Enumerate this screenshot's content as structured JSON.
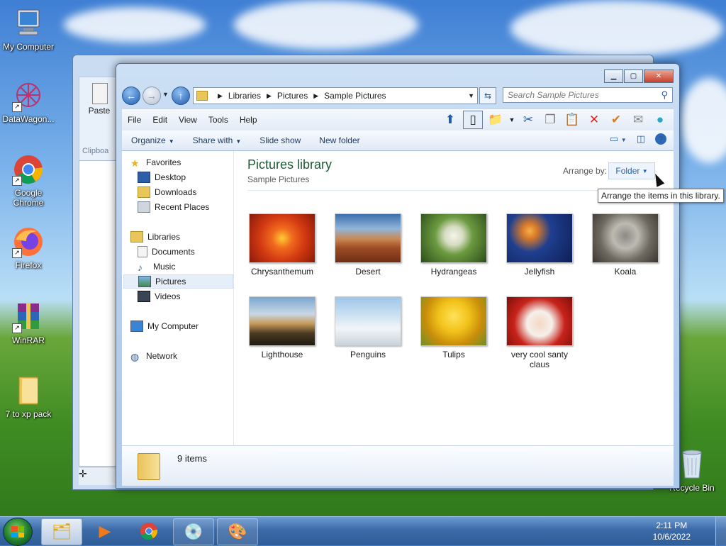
{
  "desktop": {
    "icons": [
      {
        "label": "My Computer",
        "icon": "computer-icon"
      },
      {
        "label": "DataWagon...",
        "icon": "datawagon-icon"
      },
      {
        "label": "Google Chrome",
        "icon": "chrome-icon"
      },
      {
        "label": "Firefox",
        "icon": "firefox-icon"
      },
      {
        "label": "WinRAR",
        "icon": "winrar-icon"
      },
      {
        "label": "7 to xp pack",
        "icon": "folder-icon"
      },
      {
        "label": "Recycle Bin",
        "icon": "recycle-bin-icon"
      }
    ]
  },
  "background_window": {
    "paste_label": "Paste",
    "clipboard_label": "Clipboa"
  },
  "window": {
    "address": {
      "segments": [
        "Libraries",
        "Pictures",
        "Sample Pictures"
      ]
    },
    "search": {
      "placeholder": "Search Sample Pictures"
    },
    "menu": [
      "File",
      "Edit",
      "View",
      "Tools",
      "Help"
    ],
    "commands": {
      "organize": "Organize",
      "share_with": "Share with",
      "slide_show": "Slide show",
      "new_folder": "New folder"
    },
    "nav": {
      "favorites": "Favorites",
      "desktop": "Desktop",
      "downloads": "Downloads",
      "recent_places": "Recent Places",
      "libraries": "Libraries",
      "documents": "Documents",
      "music": "Music",
      "pictures": "Pictures",
      "videos": "Videos",
      "my_computer": "My Computer",
      "network": "Network"
    },
    "library": {
      "title": "Pictures library",
      "subtitle": "Sample Pictures",
      "arrange_by_label": "Arrange by:",
      "arrange_by_value": "Folder"
    },
    "items": [
      {
        "name": "Chrysanthemum"
      },
      {
        "name": "Desert"
      },
      {
        "name": "Hydrangeas"
      },
      {
        "name": "Jellyfish"
      },
      {
        "name": "Koala"
      },
      {
        "name": "Lighthouse"
      },
      {
        "name": "Penguins"
      },
      {
        "name": "Tulips"
      },
      {
        "name": "very cool santy claus"
      }
    ],
    "details": {
      "count": "9 items"
    },
    "tooltip": "Arrange the items in this library."
  },
  "taskbar": {
    "time": "2:11 PM",
    "date": "10/6/2022"
  },
  "colors": {
    "library_title": "#1e5a34",
    "close_button": "#c9402a",
    "accent_blue": "#2a62b0"
  }
}
